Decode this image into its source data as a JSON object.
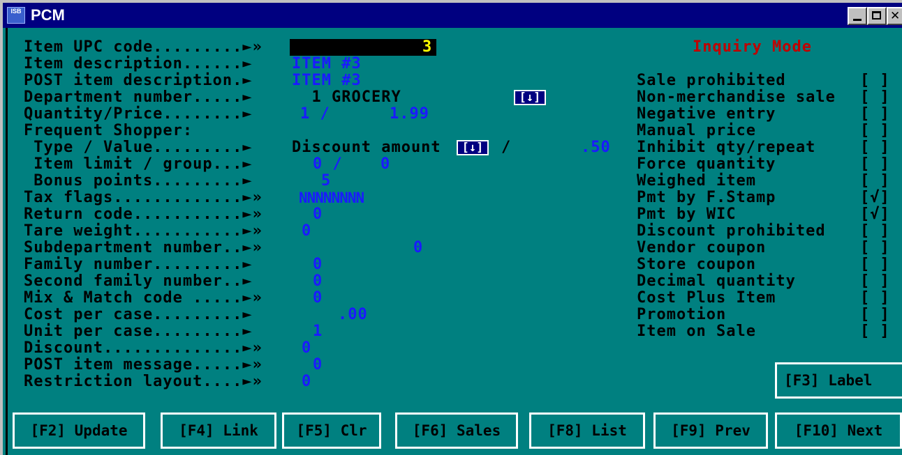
{
  "window": {
    "title": "PCM",
    "icon_text": "ISB"
  },
  "mode": "Inquiry Mode",
  "fields": {
    "upc_label": "Item UPC code.........►»",
    "upc_value": "3",
    "desc_label": "Item description......►",
    "desc_value": "ITEM #3",
    "post_desc_label": "POST item description.►",
    "post_desc_value": "ITEM #3",
    "dept_label": "Department number.....►",
    "dept_value": "  1 GROCERY",
    "qty_label": "Quantity/Price........►",
    "qty_value": "1 /",
    "price_value": "1.99",
    "fs_label": "Frequent Shopper:",
    "type_label": " Type / Value.........►",
    "type_value": "Discount amount",
    "type_slash": "/",
    "fs_value": ".50",
    "limit_label": " Item limit / group...►",
    "limit_value": "0 /",
    "group_value": "0",
    "bonus_label": " Bonus points.........►",
    "bonus_value": "5",
    "tax_label": "Tax flags.............►»",
    "tax_value": "NNNNNNNN",
    "return_label": "Return code...........►»",
    "return_value": "0",
    "tare_label": "Tare weight...........►»",
    "tare_value": "0",
    "subdept_label": "Subdepartment number..►»",
    "subdept_value": "0",
    "family_label": "Family number.........►",
    "family_value": "0",
    "family2_label": "Second family number..►",
    "family2_value": "0",
    "mix_label": "Mix & Match code .....►»",
    "mix_value": "0",
    "cost_label": "Cost per case.........►",
    "cost_value": ".00",
    "unit_label": "Unit per case.........►",
    "unit_value": "1",
    "discount_label": "Discount..............►»",
    "discount_value": "0",
    "msg_label": "POST item message.....►»",
    "msg_value": "0",
    "restrict_label": "Restriction layout....►»",
    "restrict_value": "0",
    "dropdown_glyph": "[↓]"
  },
  "flags": [
    {
      "label": "Sale prohibited",
      "box": "[ ]"
    },
    {
      "label": "Non-merchandise sale",
      "box": "[ ]"
    },
    {
      "label": "Negative entry",
      "box": "[ ]"
    },
    {
      "label": "Manual price",
      "box": "[ ]"
    },
    {
      "label": "Inhibit qty/repeat",
      "box": "[ ]"
    },
    {
      "label": "Force quantity",
      "box": "[ ]"
    },
    {
      "label": "Weighed item",
      "box": "[ ]"
    },
    {
      "label": "Pmt by F.Stamp",
      "box": "[√]"
    },
    {
      "label": "Pmt by WIC",
      "box": "[√]"
    },
    {
      "label": "Discount prohibited",
      "box": "[ ]"
    },
    {
      "label": "Vendor coupon",
      "box": "[ ]"
    },
    {
      "label": "Store coupon",
      "box": "[ ]"
    },
    {
      "label": "Decimal quantity",
      "box": "[ ]"
    },
    {
      "label": "Cost Plus Item",
      "box": "[ ]"
    },
    {
      "label": "Promotion",
      "box": "[ ]"
    },
    {
      "label": "Item on Sale",
      "box": "[ ]"
    }
  ],
  "fkeys": {
    "label": "[F3] Label",
    "update": "[F2] Update",
    "link": "[F4] Link",
    "clr": "[F5] Clr",
    "sales": "[F6] Sales",
    "list": "[F8] List",
    "prev": "[F9] Prev",
    "next": "[F10] Next"
  },
  "colors": {
    "screen_bg": "#008080",
    "title_bar": "#000080",
    "value_blue": "#1a1aff",
    "mode_red": "#c00000"
  }
}
